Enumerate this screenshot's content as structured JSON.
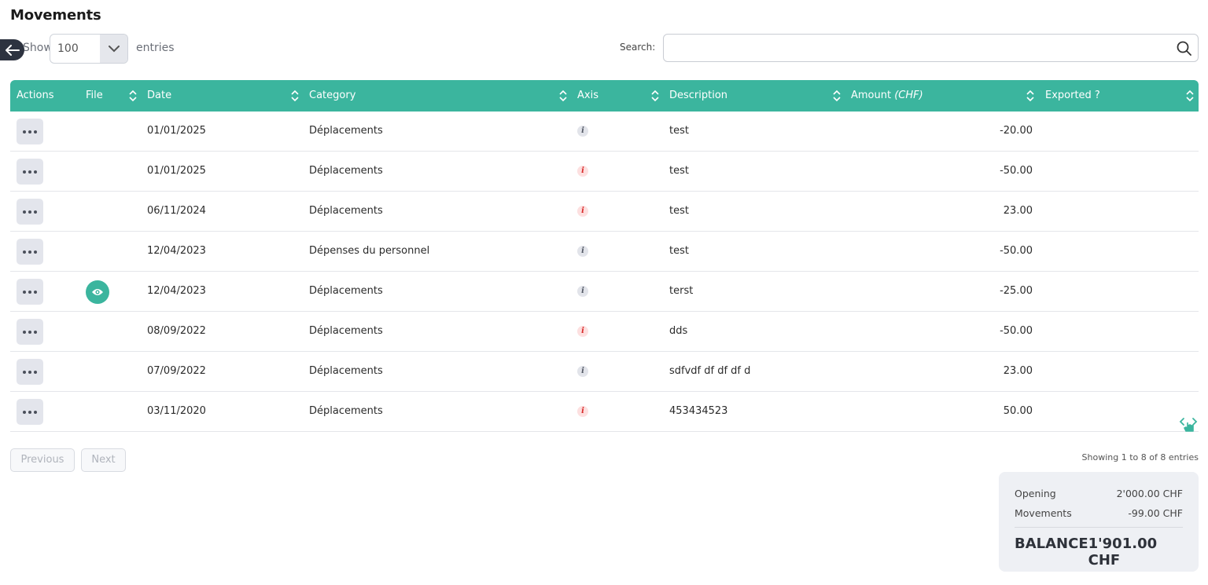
{
  "page": {
    "title": "Movements"
  },
  "length_menu": {
    "show_label": "Show",
    "value": "100",
    "entries_label": "entries"
  },
  "search": {
    "label": "Search:",
    "value": "",
    "placeholder": ""
  },
  "columns": {
    "actions": "Actions",
    "file": "File",
    "date": "Date",
    "category": "Category",
    "axis": "Axis",
    "description": "Description",
    "amount": "Amount",
    "amount_unit": "(CHF)",
    "exported": "Exported ?"
  },
  "rows": [
    {
      "date": "01/01/2025",
      "category": "Déplacements",
      "axis_status": "gray",
      "description": "test",
      "amount": "-20.00",
      "has_file": false
    },
    {
      "date": "01/01/2025",
      "category": "Déplacements",
      "axis_status": "red",
      "description": "test",
      "amount": "-50.00",
      "has_file": false
    },
    {
      "date": "06/11/2024",
      "category": "Déplacements",
      "axis_status": "red",
      "description": "test",
      "amount": "23.00",
      "has_file": false
    },
    {
      "date": "12/04/2023",
      "category": "Dépenses du personnel",
      "axis_status": "gray",
      "description": "test",
      "amount": "-50.00",
      "has_file": false
    },
    {
      "date": "12/04/2023",
      "category": "Déplacements",
      "axis_status": "gray",
      "description": "terst",
      "amount": "-25.00",
      "has_file": true
    },
    {
      "date": "08/09/2022",
      "category": "Déplacements",
      "axis_status": "red",
      "description": "dds",
      "amount": "-50.00",
      "has_file": false
    },
    {
      "date": "07/09/2022",
      "category": "Déplacements",
      "axis_status": "gray",
      "description": "sdfvdf df df df d",
      "amount": "23.00",
      "has_file": false
    },
    {
      "date": "03/11/2020",
      "category": "Déplacements",
      "axis_status": "red",
      "description": "453434523",
      "amount": "50.00",
      "has_file": false
    }
  ],
  "pagination": {
    "previous": "Previous",
    "next": "Next",
    "info": "Showing 1 to 8 of 8 entries"
  },
  "summary": {
    "opening_label": "Opening",
    "opening_value": "2'000.00 CHF",
    "movements_label": "Movements",
    "movements_value": "-99.00 CHF",
    "balance_label": "BALANCE",
    "balance_value": "1'901.00 CHF"
  },
  "icons": {
    "axis_info": "i"
  },
  "colors": {
    "accent": "#3bb59e",
    "info_red": "#d92b2b",
    "info_gray": "#555a66",
    "dark": "#2d3340"
  }
}
